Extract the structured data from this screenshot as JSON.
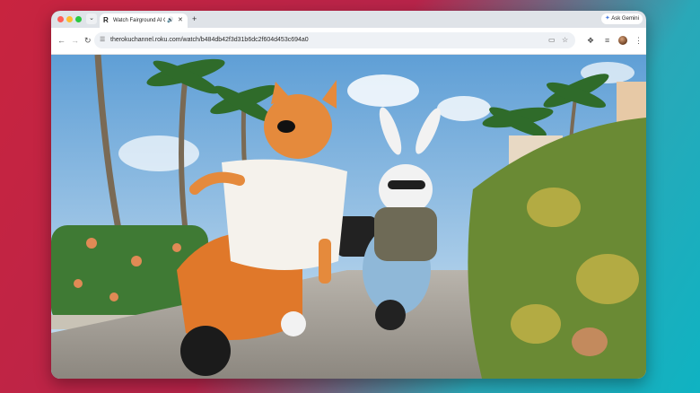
{
  "tab": {
    "title": "Watch Fairground AI Cre",
    "favicon_letter": "R",
    "audio_icon": "speaker-icon",
    "close_icon": "close-icon"
  },
  "new_tab_icon": "plus-icon",
  "gemini": {
    "label": "Ask Gemini",
    "icon": "sparkle-icon"
  },
  "address_bar": {
    "url": "therokuchannel.roku.com/watch/b484db42f3d31b6dc2f604d453c694a0"
  },
  "icons": {
    "back": "back-arrow-icon",
    "forward": "forward-arrow-icon",
    "reload": "reload-icon",
    "site_info": "tune-icon",
    "cast": "cast-icon",
    "bookmark": "star-icon",
    "extensions": "puzzle-icon",
    "media": "media-controls-icon",
    "menu": "kebab-menu-icon"
  },
  "video": {
    "description_hidden": ""
  },
  "colors": {
    "traffic_red": "#ff5f57",
    "traffic_yellow": "#febc2e",
    "traffic_green": "#28c840",
    "scooter_orange": "#e0782a",
    "scooter_blue": "#8fb8d8"
  }
}
